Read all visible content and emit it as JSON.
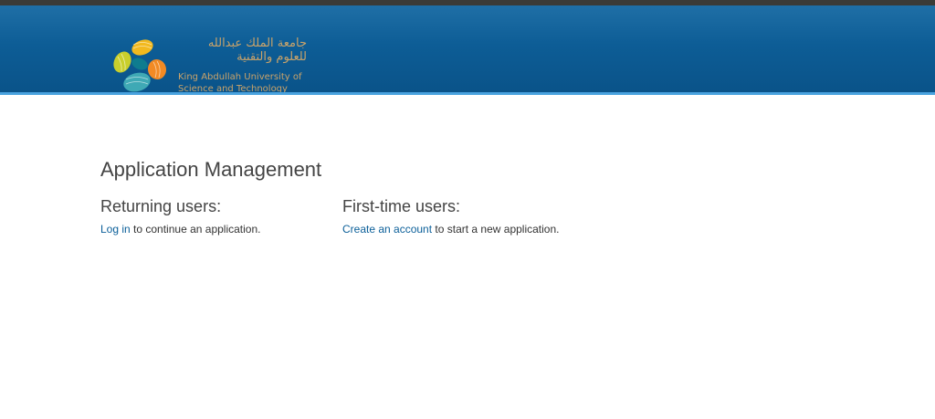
{
  "header": {
    "logo_arabic_line1": "جامعة الملك عبدالله",
    "logo_arabic_line2": "للعلوم والتقنية",
    "logo_english_line1": "King Abdullah University of",
    "logo_english_line2": "Science and Technology",
    "colors": {
      "strip": "#3b3b37",
      "banner": "#0d5d96",
      "accent_line": "#4aa3df",
      "logo_text": "#c9a36a"
    }
  },
  "main": {
    "title": "Application Management",
    "returning": {
      "heading": "Returning users:",
      "link": "Log in",
      "text": " to continue an application."
    },
    "first_time": {
      "heading": "First-time users:",
      "link": "Create an account",
      "text": " to start a new application."
    },
    "link_color": "#0b5f99"
  }
}
